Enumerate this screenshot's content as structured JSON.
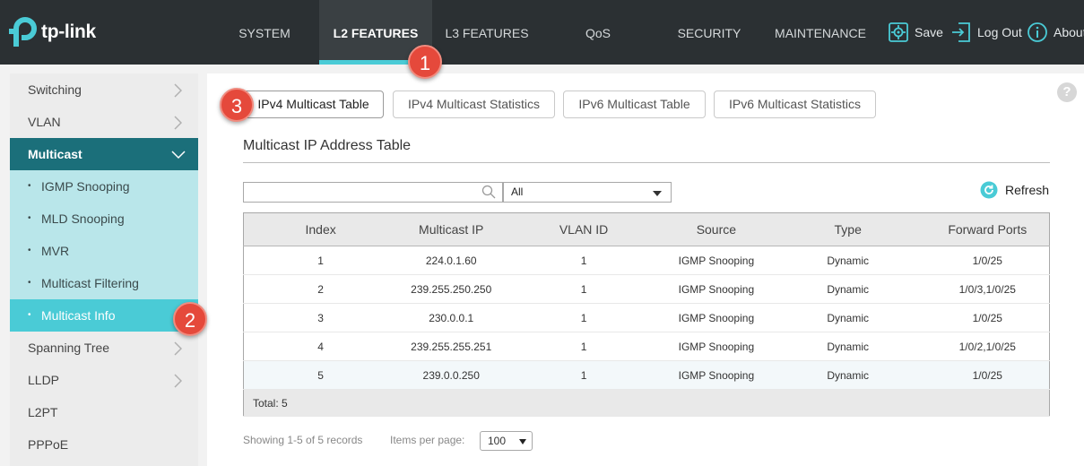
{
  "brand": {
    "name": "tp-link",
    "accent": "#4acbd6",
    "callout_color": "#e5493b"
  },
  "nav": {
    "tabs": [
      {
        "label": "SYSTEM"
      },
      {
        "label": "L2 FEATURES"
      },
      {
        "label": "L3 FEATURES"
      },
      {
        "label": "QoS"
      },
      {
        "label": "SECURITY"
      },
      {
        "label": "MAINTENANCE"
      }
    ],
    "active_tab": "L2 FEATURES",
    "tools": {
      "save": "Save",
      "logout": "Log Out",
      "about": "About"
    }
  },
  "sidebar": {
    "items": [
      {
        "label": "Switching"
      },
      {
        "label": "VLAN"
      },
      {
        "label": "Multicast"
      },
      {
        "label": "IGMP Snooping"
      },
      {
        "label": "MLD Snooping"
      },
      {
        "label": "MVR"
      },
      {
        "label": "Multicast Filtering"
      },
      {
        "label": "Multicast Info"
      },
      {
        "label": "Spanning Tree"
      },
      {
        "label": "LLDP"
      },
      {
        "label": "L2PT"
      },
      {
        "label": "PPPoE"
      }
    ],
    "active_item": "Multicast Info"
  },
  "subtabs": [
    {
      "label": "IPv4 Multicast Table"
    },
    {
      "label": "IPv4 Multicast Statistics"
    },
    {
      "label": "IPv6 Multicast Table"
    },
    {
      "label": "IPv6 Multicast Statistics"
    }
  ],
  "help_label": "?",
  "section": {
    "title": "Multicast IP Address Table"
  },
  "filter": {
    "search_value": "",
    "select_value": "All",
    "refresh_label": "Refresh"
  },
  "table": {
    "columns": [
      "Index",
      "Multicast IP",
      "VLAN ID",
      "Source",
      "Type",
      "Forward Ports"
    ],
    "rows": [
      [
        "1",
        "224.0.1.60",
        "1",
        "IGMP Snooping",
        "Dynamic",
        "1/0/25"
      ],
      [
        "2",
        "239.255.250.250",
        "1",
        "IGMP Snooping",
        "Dynamic",
        "1/0/3,1/0/25"
      ],
      [
        "3",
        "230.0.0.1",
        "1",
        "IGMP Snooping",
        "Dynamic",
        "1/0/25"
      ],
      [
        "4",
        "239.255.255.251",
        "1",
        "IGMP Snooping",
        "Dynamic",
        "1/0/2,1/0/25"
      ],
      [
        "5",
        "239.0.0.250",
        "1",
        "IGMP Snooping",
        "Dynamic",
        "1/0/25"
      ]
    ],
    "total": "Total: 5"
  },
  "footer": {
    "showing": "Showing 1-5 of 5 records",
    "items_per_page_label": "Items per page:",
    "items_per_page": "100"
  },
  "callouts": [
    "1",
    "2",
    "3"
  ]
}
